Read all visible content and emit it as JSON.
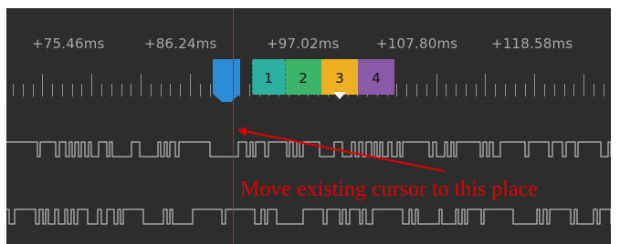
{
  "timeline": {
    "labels": [
      "+75.46ms",
      "+86.24ms",
      "+97.02ms",
      "+107.80ms",
      "+118.58ms"
    ]
  },
  "markers": [
    {
      "label": "",
      "color": "#2a8fd6"
    },
    {
      "label": "1",
      "color": "#2eb0a0"
    },
    {
      "label": "2",
      "color": "#3cb46a"
    },
    {
      "label": "3",
      "color": "#f0b023"
    },
    {
      "label": "4",
      "color": "#8a5aa8"
    }
  ],
  "colors": {
    "panel_bg": "#2d2d2d",
    "tick": "#8f8f8f",
    "waveform": "#bdbdbd",
    "cursor_line": "#e01818",
    "annotation": "#e00000"
  },
  "annotation": {
    "text": "Move existing cursor to this place"
  },
  "icons": [
    "cursor-pointer-icon",
    "selected-marker-triangle-icon",
    "arrow-icon"
  ]
}
